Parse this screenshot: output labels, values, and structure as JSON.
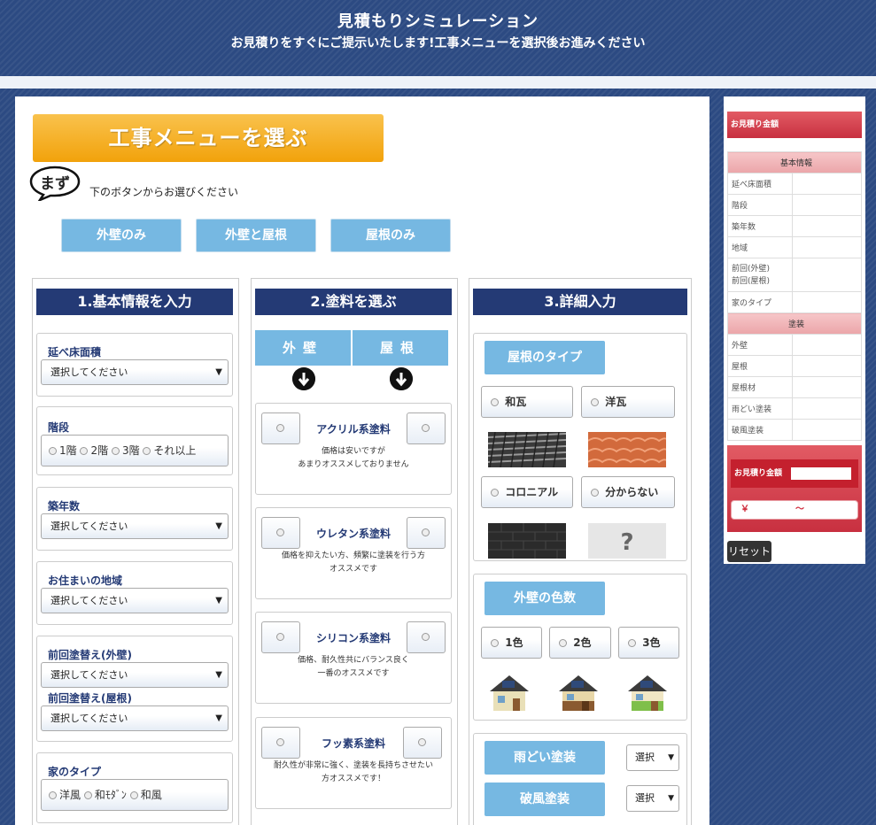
{
  "header": {
    "title": "見積もりシミュレーション",
    "subtitle": "お見積りをすぐにご提示いたします!工事メニューを選択後お進みください"
  },
  "banner": {
    "label": "工事メニューを選ぶ"
  },
  "intro": {
    "badge": "まず",
    "text": "下のボタンからお選びください"
  },
  "menu_buttons": [
    "外壁のみ",
    "外壁と屋根",
    "屋根のみ"
  ],
  "col1": {
    "heading": "1.基本情報を入力",
    "floor_area": {
      "label": "延べ床面積",
      "value": "選択してください"
    },
    "stories": {
      "label": "階段",
      "options": [
        "1階",
        "2階",
        "3階",
        "それ以上"
      ]
    },
    "age": {
      "label": "築年数",
      "value": "選択してください"
    },
    "region": {
      "label": "お住まいの地域",
      "value": "選択してください"
    },
    "prev_wall": {
      "label": "前回塗替え(外壁)",
      "value": "選択してください"
    },
    "prev_roof": {
      "label": "前回塗替え(屋根)",
      "value": "選択してください"
    },
    "house_type": {
      "label": "家のタイプ",
      "options": [
        "洋風",
        "和ﾓﾀﾞﾝ",
        "和風"
      ]
    }
  },
  "col2": {
    "heading": "2.塗料を選ぶ",
    "tabs": [
      "外壁",
      "屋根"
    ],
    "paints": [
      {
        "name": "アクリル系塗料",
        "desc1": "価格は安いですが",
        "desc2": "あまりオススメしておりません"
      },
      {
        "name": "ウレタン系塗料",
        "desc1": "価格を抑えたい方、頻繁に塗装を行う方",
        "desc2": "オススメです"
      },
      {
        "name": "シリコン系塗料",
        "desc1": "価格、耐久性共にバランス良く",
        "desc2": "一番のオススメです"
      },
      {
        "name": "フッ素系塗料",
        "desc1": "耐久性が非常に強く、塗装を長持ちさせたい",
        "desc2": "方オススメです！"
      }
    ]
  },
  "col3": {
    "heading": "3.詳細入力",
    "roof_type": {
      "label": "屋根のタイプ",
      "options": [
        "和瓦",
        "洋瓦",
        "コロニアル",
        "分からない"
      ]
    },
    "wall_colors": {
      "label": "外壁の色数",
      "options": [
        "1色",
        "2色",
        "3色"
      ]
    },
    "gutter": {
      "label": "雨どい塗装",
      "value": "選択"
    },
    "bargeboard": {
      "label": "破風塗装",
      "value": "選択"
    }
  },
  "sidebar": {
    "title": "お見積り金額",
    "basic_heading": "基本情報",
    "basic_rows": [
      "延べ床面積",
      "階段",
      "築年数",
      "地域",
      "前回(外壁)",
      "前回(屋根)",
      "家のタイプ"
    ],
    "paint_heading": "塗装",
    "paint_rows": [
      "外壁",
      "屋根",
      "屋根材",
      "雨どい塗装",
      "破風塗装"
    ],
    "total_label": "お見積り金額",
    "yen": "￥",
    "tilde": "～",
    "reset": "リセット"
  },
  "colors": {
    "navy": "#243a75",
    "sky": "#76b8e2",
    "orange": "#f2a20b",
    "red": "#c83040"
  }
}
